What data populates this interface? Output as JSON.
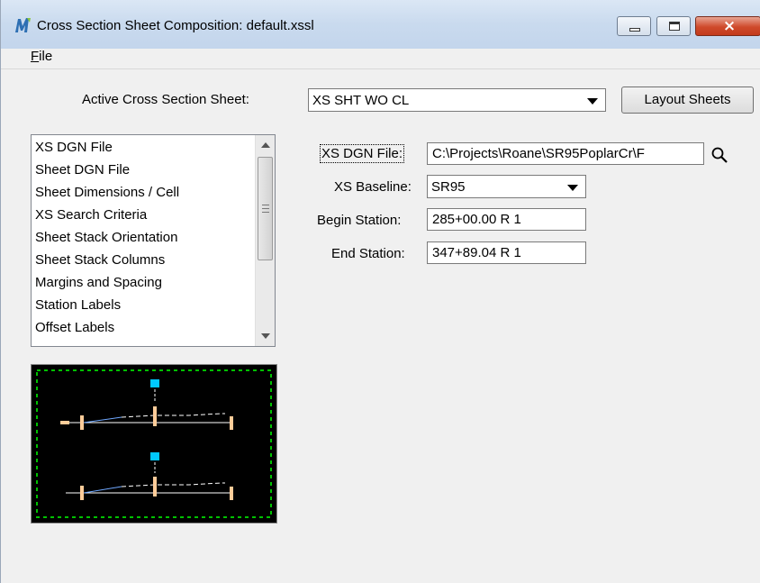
{
  "window": {
    "title": "Cross Section Sheet Composition: default.xssl",
    "icon": "microstation-m-icon",
    "controls": {
      "minimize": "minimize-icon",
      "maximize": "maximize-icon",
      "close": "×"
    }
  },
  "menu": {
    "file_mnemonic": "F",
    "file_rest": "ile"
  },
  "sheet": {
    "label": "Active Cross Section Sheet:",
    "value": "XS SHT WO CL",
    "layout_button": "Layout Sheets"
  },
  "categories": {
    "items": [
      "XS DGN File",
      "Sheet DGN File",
      "Sheet Dimensions / Cell",
      "XS Search Criteria",
      "Sheet Stack Orientation",
      "Sheet Stack Columns",
      "Margins and Spacing",
      "Station Labels",
      "Offset Labels"
    ]
  },
  "fields": {
    "xs_dgn_file_label": "XS DGN File:",
    "xs_dgn_file_value": "C:\\Projects\\Roane\\SR95PoplarCr\\F",
    "xs_baseline_label": "XS Baseline:",
    "xs_baseline_value": "SR95",
    "begin_station_label": "Begin Station:",
    "begin_station_value": "285+00.00 R 1",
    "end_station_label": "End Station:",
    "end_station_value": "347+89.04 R 1"
  },
  "colors": {
    "preview_background": "#000000",
    "preview_border": "#00c000",
    "cell_label": "#00c8ff",
    "ground_line": "#ffffff",
    "section_block": "#ffcc99"
  }
}
